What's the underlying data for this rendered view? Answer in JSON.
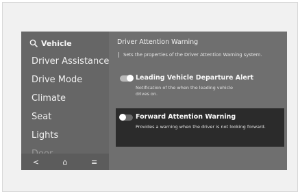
{
  "sidebar": {
    "header": "Vehicle",
    "items": [
      {
        "label": "Driver Assistance"
      },
      {
        "label": "Drive Mode"
      },
      {
        "label": "Climate"
      },
      {
        "label": "Seat"
      },
      {
        "label": "Lights"
      },
      {
        "label": "Door"
      }
    ],
    "bottom_nav": {
      "back_glyph": "<",
      "home_glyph": "⌂",
      "menu_glyph": "≡"
    }
  },
  "main": {
    "title": "Driver Attention Warning",
    "description": "Sets the properties of the Driver Attention Warning system.",
    "settings": [
      {
        "title": "Leading Vehicle Departure Alert",
        "description": "Notification of the when the leading vehicle drives on.",
        "enabled": true
      },
      {
        "title": "Forward Attention Warning",
        "description": "Provides a warning when the driver is not looking forward.",
        "enabled": false
      }
    ]
  },
  "colors": {
    "screen_bg": "#6f6f6f",
    "sidebar_bg": "#666666",
    "selected_row_bg": "#2b2b2b",
    "text": "#f2f2f2"
  },
  "icons": [
    "search-icon",
    "back-icon",
    "home-icon",
    "menu-icon",
    "toggle-switch"
  ]
}
